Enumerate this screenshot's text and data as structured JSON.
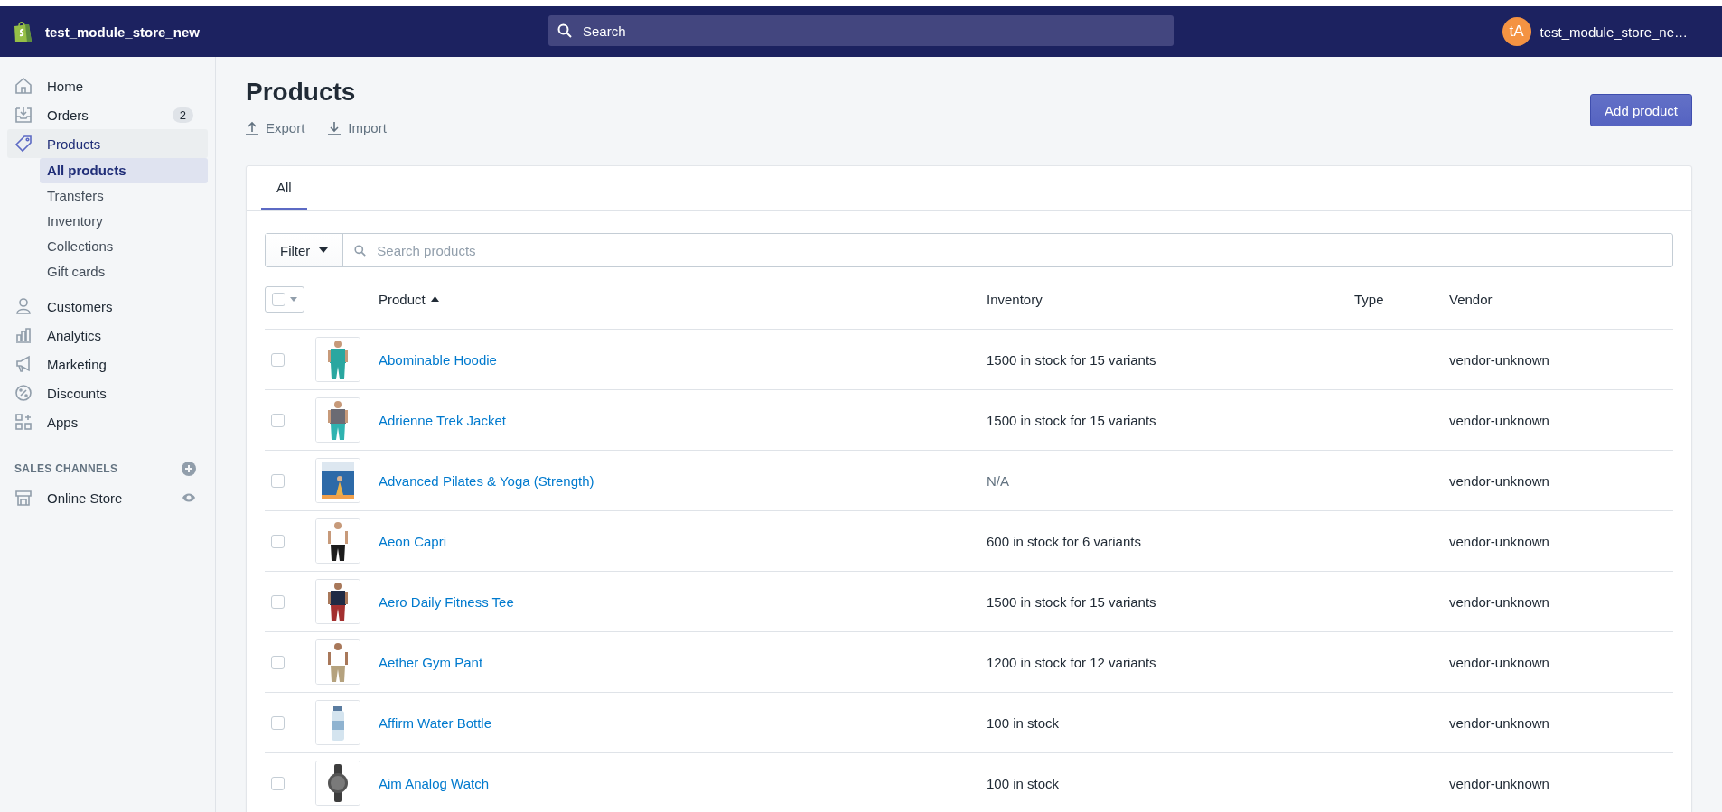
{
  "topbar": {
    "store_name": "test_module_store_new",
    "search": {
      "placeholder": "Search"
    },
    "account": {
      "initials": "tA",
      "name": "test_module_store_ne…"
    }
  },
  "sidebar": {
    "items": [
      {
        "label": "Home",
        "selected": false
      },
      {
        "label": "Orders",
        "selected": false,
        "badge": "2"
      },
      {
        "label": "Products",
        "selected": true,
        "children": [
          {
            "label": "All products",
            "selected": true
          },
          {
            "label": "Transfers",
            "selected": false
          },
          {
            "label": "Inventory",
            "selected": false
          },
          {
            "label": "Collections",
            "selected": false
          },
          {
            "label": "Gift cards",
            "selected": false
          }
        ]
      },
      {
        "label": "Customers",
        "selected": false
      },
      {
        "label": "Analytics",
        "selected": false
      },
      {
        "label": "Marketing",
        "selected": false
      },
      {
        "label": "Discounts",
        "selected": false
      },
      {
        "label": "Apps",
        "selected": false
      }
    ],
    "sales_channels": {
      "title": "SALES CHANNELS",
      "items": [
        {
          "label": "Online Store"
        }
      ]
    }
  },
  "page": {
    "title": "Products",
    "actions": [
      "Export",
      "Import"
    ],
    "primary_button": "Add product"
  },
  "tabs": [
    {
      "label": "All",
      "selected": true
    }
  ],
  "filter": {
    "button": "Filter",
    "search": {
      "placeholder": "Search products"
    }
  },
  "table": {
    "select_all": {
      "checked": false
    },
    "columns": [
      {
        "label": "Product",
        "sorted": true
      },
      {
        "label": "Inventory",
        "sorted": false
      },
      {
        "label": "Type",
        "sorted": false
      },
      {
        "label": "Vendor",
        "sorted": false
      }
    ],
    "rows": [
      {
        "product": "Abominable Hoodie",
        "inventory": "1500 in stock for 15 variants",
        "muted": false,
        "vendor": "vendor-unknown",
        "checked": false
      },
      {
        "product": "Adrienne Trek Jacket",
        "inventory": "1500 in stock for 15 variants",
        "muted": false,
        "vendor": "vendor-unknown",
        "checked": false
      },
      {
        "product": "Advanced Pilates & Yoga (Strength)",
        "inventory": "N/A",
        "muted": true,
        "vendor": "vendor-unknown",
        "checked": false
      },
      {
        "product": "Aeon Capri",
        "inventory": "600 in stock for 6 variants",
        "muted": false,
        "vendor": "vendor-unknown",
        "checked": false
      },
      {
        "product": "Aero Daily Fitness Tee",
        "inventory": "1500 in stock for 15 variants",
        "muted": false,
        "vendor": "vendor-unknown",
        "checked": false
      },
      {
        "product": "Aether Gym Pant",
        "inventory": "1200 in stock for 12 variants",
        "muted": false,
        "vendor": "vendor-unknown",
        "checked": false
      },
      {
        "product": "Affirm Water Bottle",
        "inventory": "100 in stock",
        "muted": false,
        "vendor": "vendor-unknown",
        "checked": false
      },
      {
        "product": "Aim Analog Watch",
        "inventory": "100 in stock",
        "muted": false,
        "vendor": "vendor-unknown",
        "checked": false
      }
    ]
  }
}
